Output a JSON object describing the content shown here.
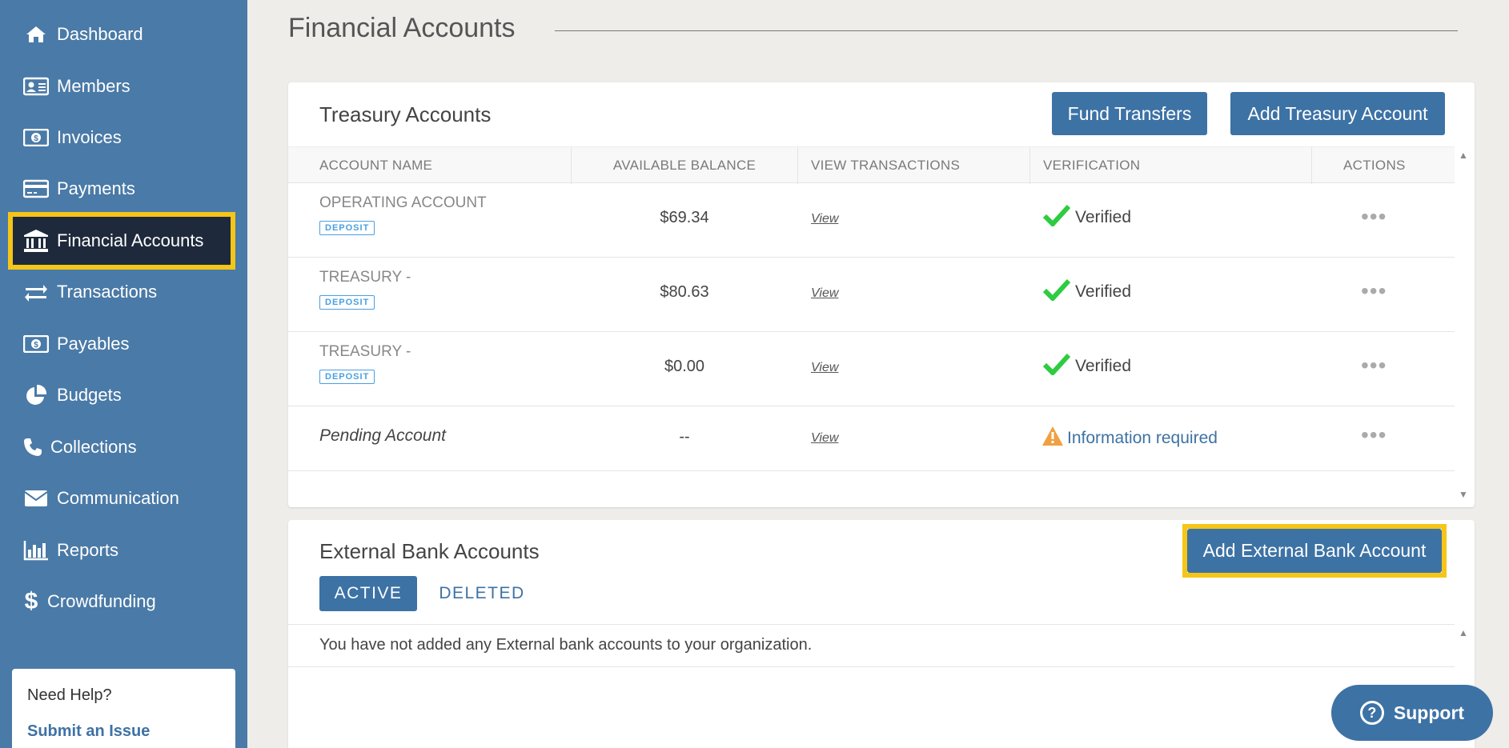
{
  "sidebar": {
    "items": [
      {
        "label": "Dashboard",
        "icon": "home-icon"
      },
      {
        "label": "Members",
        "icon": "id-card-icon"
      },
      {
        "label": "Invoices",
        "icon": "money-icon"
      },
      {
        "label": "Payments",
        "icon": "credit-card-icon"
      },
      {
        "label": "Financial Accounts",
        "icon": "bank-icon",
        "active": true
      },
      {
        "label": "Transactions",
        "icon": "exchange-icon"
      },
      {
        "label": "Payables",
        "icon": "money-icon"
      },
      {
        "label": "Budgets",
        "icon": "pie-chart-icon"
      },
      {
        "label": "Collections",
        "icon": "phone-icon"
      },
      {
        "label": "Communication",
        "icon": "envelope-icon"
      },
      {
        "label": "Reports",
        "icon": "bar-chart-icon"
      },
      {
        "label": "Crowdfunding",
        "icon": "dollar-icon"
      }
    ],
    "help": {
      "title": "Need Help?",
      "link": "Submit an Issue"
    }
  },
  "header": {
    "title": "Financial Accounts"
  },
  "treasury": {
    "title": "Treasury Accounts",
    "fund_transfers": "Fund Transfers",
    "add_treasury": "Add Treasury Account",
    "columns": [
      "ACCOUNT NAME",
      "AVAILABLE BALANCE",
      "VIEW TRANSACTIONS",
      "VERIFICATION",
      "ACTIONS"
    ],
    "rows": [
      {
        "name": "OPERATING ACCOUNT",
        "badge": "DEPOSIT",
        "balance": "$69.34",
        "view": "View",
        "verification": "Verified",
        "actions": "•••"
      },
      {
        "name": "TREASURY -",
        "badge": "DEPOSIT",
        "balance": "$80.63",
        "view": "View",
        "verification": "Verified",
        "actions": "•••"
      },
      {
        "name": "TREASURY -",
        "badge": "DEPOSIT",
        "balance": "$0.00",
        "view": "View",
        "verification": "Verified",
        "actions": "•••"
      },
      {
        "name": "Pending Account",
        "balance": "--",
        "view": "View",
        "verification": "Information required",
        "actions": "•••"
      }
    ]
  },
  "external": {
    "title": "External Bank Accounts",
    "add_button": "Add External Bank Account",
    "tab_active": "ACTIVE",
    "tab_deleted": "DELETED",
    "empty_message": "You have not added any External bank accounts to your organization."
  },
  "support": {
    "label": "Support"
  },
  "colors": {
    "sidebar": "#4a7aa7",
    "active_bg": "#1e2a3c",
    "highlight": "#f5c518",
    "primary": "#3d72a5",
    "verified": "#2ecc40",
    "warning": "#f0a040"
  }
}
